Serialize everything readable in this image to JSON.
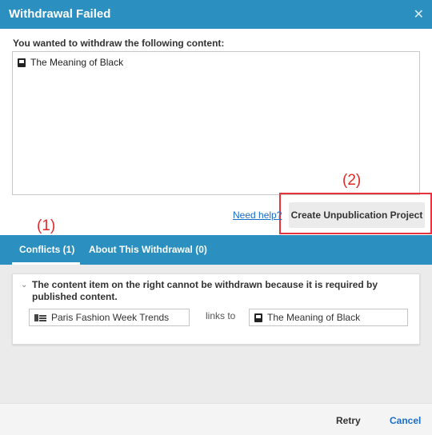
{
  "dialog": {
    "title": "Withdrawal Failed",
    "close_icon": "close-icon"
  },
  "intro_text": "You wanted to withdraw the following content:",
  "content_list": [
    {
      "icon": "document-icon",
      "label": "The Meaning of Black"
    }
  ],
  "help_link": "Need help?",
  "create_button": "Create Unpublication Project",
  "annotations": {
    "tabs_marker": "(1)",
    "button_marker": "(2)",
    "highlight_color": "#e8323c"
  },
  "tabs": [
    {
      "label": "Conflicts (1)",
      "active": true
    },
    {
      "label": "About This Withdrawal (0)",
      "active": false
    }
  ],
  "conflicts": [
    {
      "message": "The content item on the right cannot be withdrawn because it is required by published content.",
      "source": {
        "icon": "article-icon",
        "label": "Paris Fashion Week Trends"
      },
      "relation": "links to",
      "target": {
        "icon": "document-icon",
        "label": "The Meaning of Black"
      }
    }
  ],
  "footer": {
    "retry": "Retry",
    "cancel": "Cancel"
  },
  "colors": {
    "header": "#2b8fbf",
    "link": "#1a6ec8",
    "annotation": "#e02a2a"
  }
}
